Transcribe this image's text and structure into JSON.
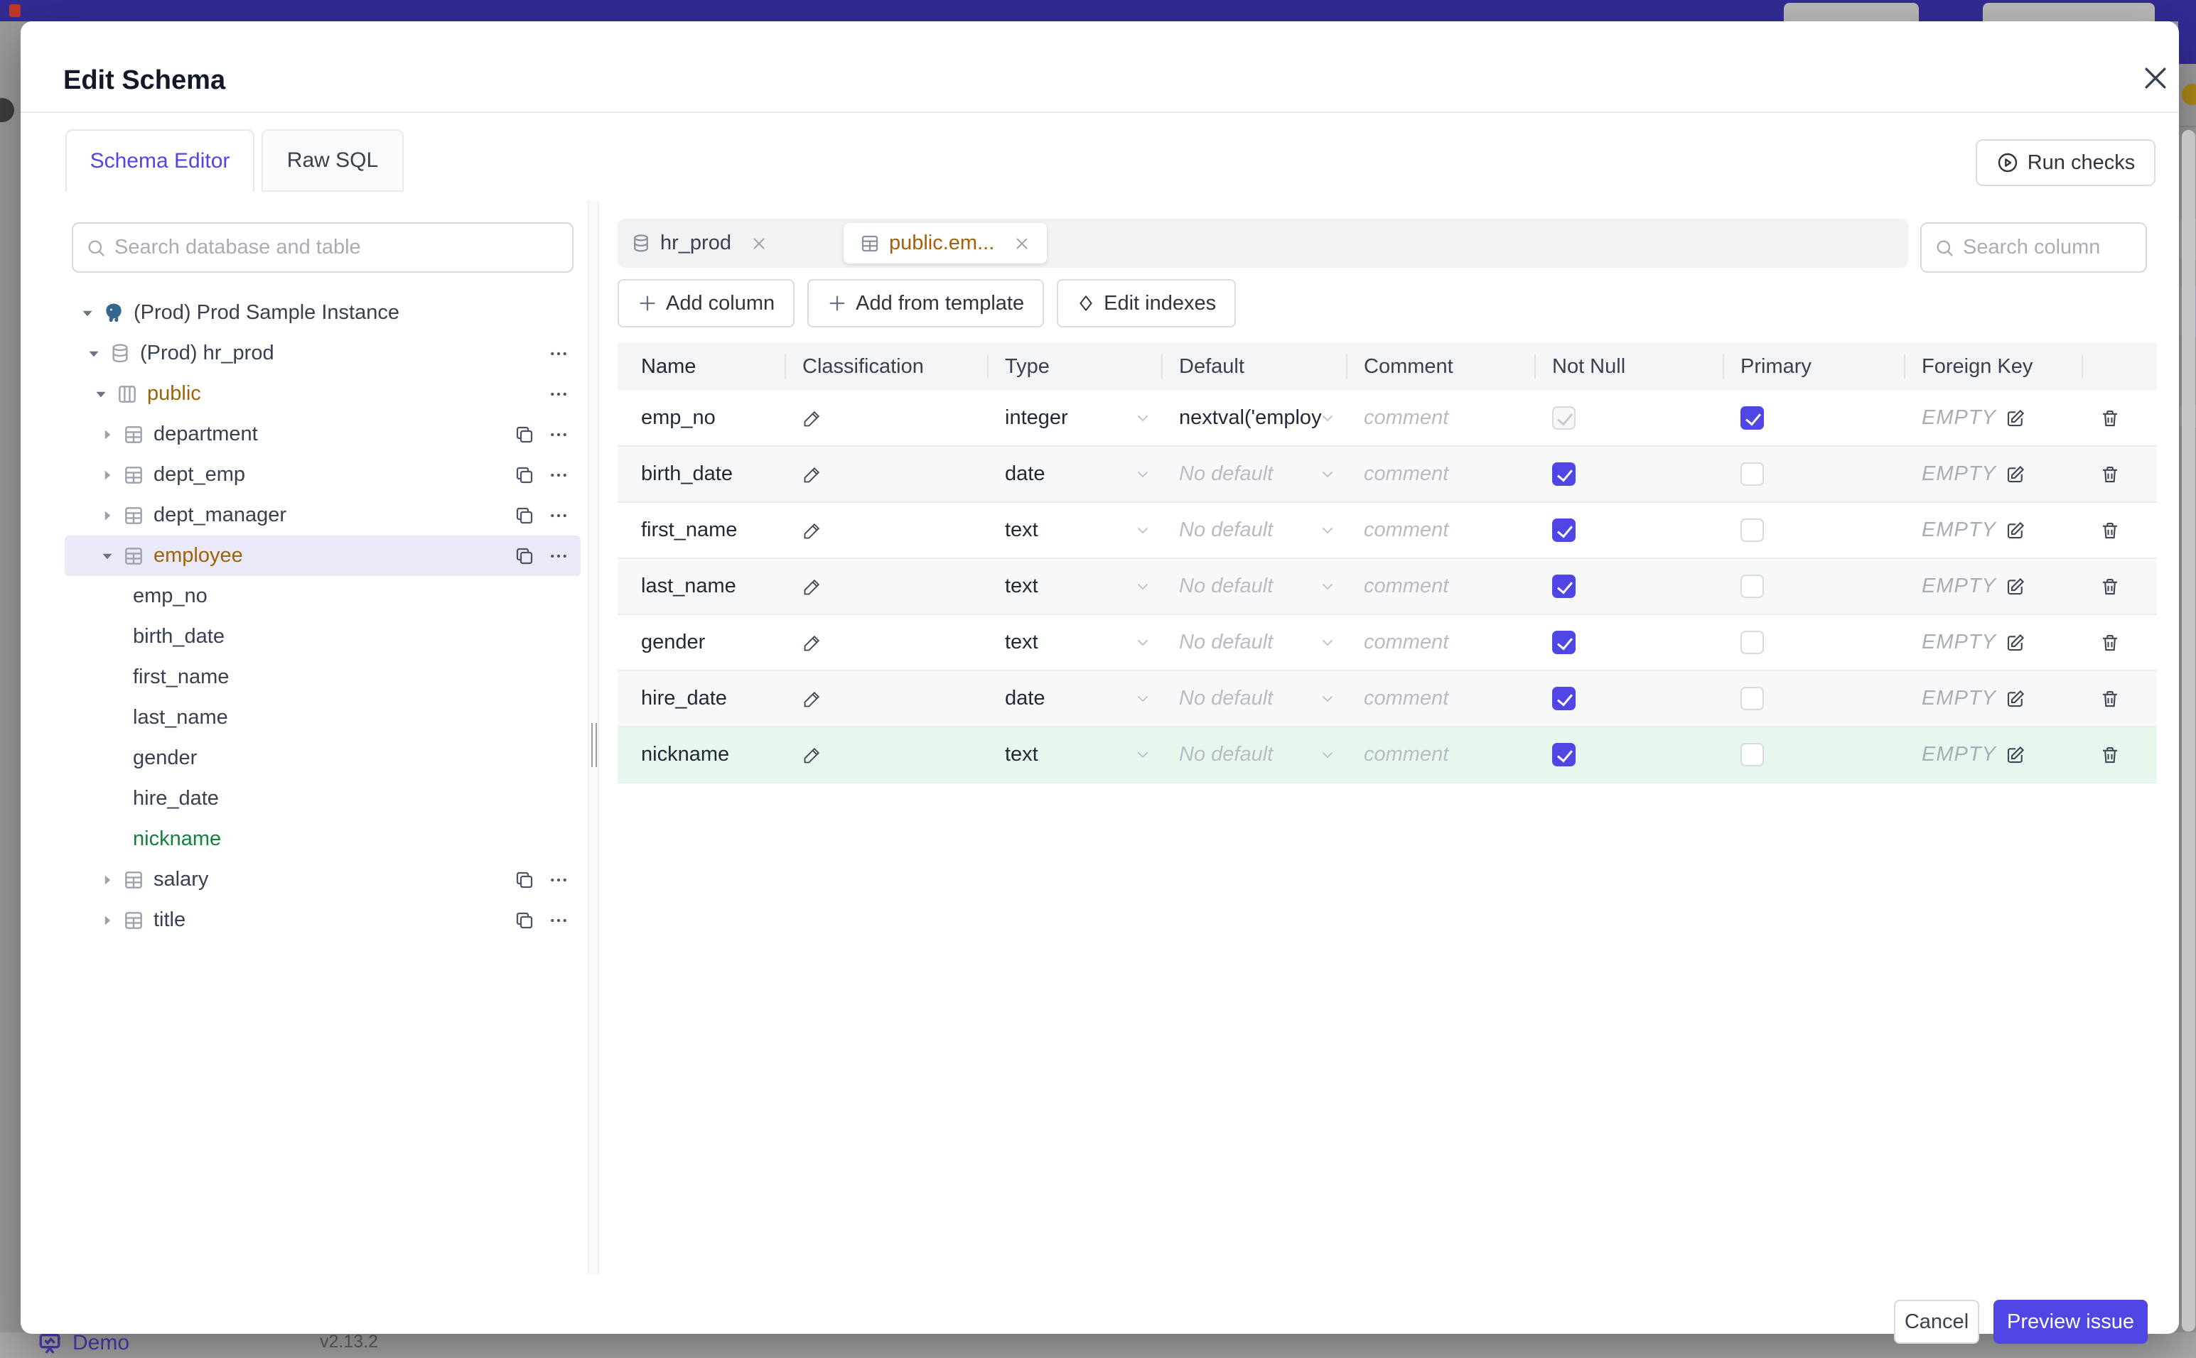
{
  "colors": {
    "accent_indigo": "#4f46e5",
    "modified_amber": "#a16207",
    "added_green": "#15803d",
    "background_topbar": "#322c94",
    "selected_row_bg": "#e9e9f8",
    "added_row_bg": "#e8f7ee"
  },
  "background": {
    "demo_label": "Demo",
    "version": "v2.13.2"
  },
  "modal": {
    "title": "Edit Schema",
    "tabs": [
      {
        "label": "Schema Editor",
        "active": true
      },
      {
        "label": "Raw SQL",
        "active": false
      }
    ],
    "run_checks_label": "Run checks",
    "footer": {
      "cancel_label": "Cancel",
      "primary_label": "Preview issue"
    }
  },
  "sidebar": {
    "search_placeholder": "Search database and table",
    "tree": [
      {
        "label": "(Prod) Prod Sample Instance",
        "type": "instance",
        "expanded": true
      },
      {
        "label": "(Prod) hr_prod",
        "type": "database",
        "expanded": true
      },
      {
        "label": "public",
        "type": "schema",
        "expanded": true,
        "modified": true
      },
      {
        "label": "department",
        "type": "table"
      },
      {
        "label": "dept_emp",
        "type": "table"
      },
      {
        "label": "dept_manager",
        "type": "table"
      },
      {
        "label": "employee",
        "type": "table",
        "expanded": true,
        "selected": true,
        "modified": true
      },
      {
        "label": "emp_no",
        "type": "column"
      },
      {
        "label": "birth_date",
        "type": "column"
      },
      {
        "label": "first_name",
        "type": "column"
      },
      {
        "label": "last_name",
        "type": "column"
      },
      {
        "label": "gender",
        "type": "column"
      },
      {
        "label": "hire_date",
        "type": "column"
      },
      {
        "label": "nickname",
        "type": "column",
        "added": true
      },
      {
        "label": "salary",
        "type": "table"
      },
      {
        "label": "title",
        "type": "table"
      }
    ]
  },
  "editor": {
    "tabs": [
      {
        "label": "hr_prod",
        "icon": "database-icon",
        "active": false
      },
      {
        "label": "public.em...",
        "icon": "table-icon",
        "active": true,
        "modified": true
      }
    ],
    "search_placeholder": "Search column",
    "toolbar": {
      "add_column": "Add column",
      "add_from_template": "Add from template",
      "edit_indexes": "Edit indexes"
    },
    "table": {
      "headers": [
        "Name",
        "Classification",
        "Type",
        "Default",
        "Comment",
        "Not Null",
        "Primary",
        "Foreign Key"
      ],
      "comment_placeholder": "comment",
      "fk_empty_label": "EMPTY",
      "no_default_label": "No default",
      "rows": [
        {
          "name": "emp_no",
          "type": "integer",
          "default": "nextval('employ",
          "default_is_set": true,
          "not_null": true,
          "not_null_disabled": true,
          "primary": true,
          "added": false
        },
        {
          "name": "birth_date",
          "type": "date",
          "default": "No default",
          "default_is_set": false,
          "not_null": true,
          "not_null_disabled": false,
          "primary": false,
          "added": false
        },
        {
          "name": "first_name",
          "type": "text",
          "default": "No default",
          "default_is_set": false,
          "not_null": true,
          "not_null_disabled": false,
          "primary": false,
          "added": false
        },
        {
          "name": "last_name",
          "type": "text",
          "default": "No default",
          "default_is_set": false,
          "not_null": true,
          "not_null_disabled": false,
          "primary": false,
          "added": false
        },
        {
          "name": "gender",
          "type": "text",
          "default": "No default",
          "default_is_set": false,
          "not_null": true,
          "not_null_disabled": false,
          "primary": false,
          "added": false
        },
        {
          "name": "hire_date",
          "type": "date",
          "default": "No default",
          "default_is_set": false,
          "not_null": true,
          "not_null_disabled": false,
          "primary": false,
          "added": false
        },
        {
          "name": "nickname",
          "type": "text",
          "default": "No default",
          "default_is_set": false,
          "not_null": true,
          "not_null_disabled": false,
          "primary": false,
          "added": true
        }
      ]
    }
  }
}
